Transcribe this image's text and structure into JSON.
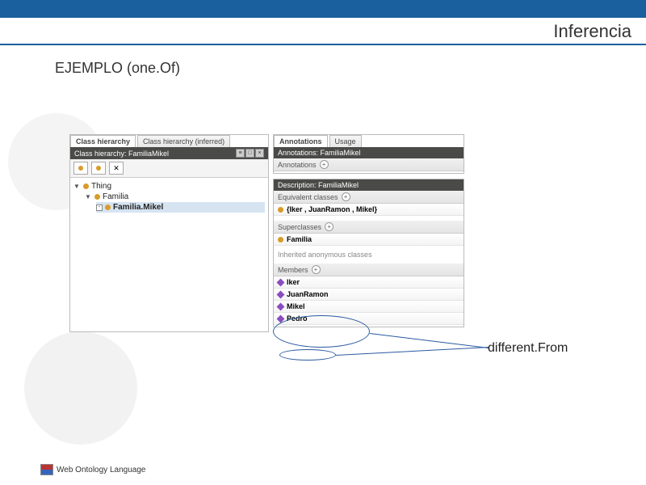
{
  "header": {
    "title": "Inferencia",
    "subtitle": "EJEMPLO (one.Of)"
  },
  "left": {
    "tabs": [
      "Class hierarchy",
      "Class hierarchy (inferred)"
    ],
    "darkbar": "Class hierarchy: FamiliaMikel",
    "tree": {
      "root": "Thing",
      "child1": "Familia",
      "child2": "Familia.Mikel"
    }
  },
  "right": {
    "annTabs": [
      "Annotations",
      "Usage"
    ],
    "annBar": "Annotations: FamiliaMikel",
    "annHead": "Annotations",
    "descBar": "Description: FamiliaMikel",
    "equivHead": "Equivalent classes",
    "equivRow": "{Iker , JuanRamon , Mikel}",
    "superHead": "Superclasses",
    "superRow": "Familia",
    "inheritedHead": "Inherited anonymous classes",
    "membersHead": "Members",
    "members": [
      "Iker",
      "JuanRamon",
      "Mikel",
      "Pedro"
    ]
  },
  "annotation": "different.From",
  "footer": "Web Ontology Language"
}
